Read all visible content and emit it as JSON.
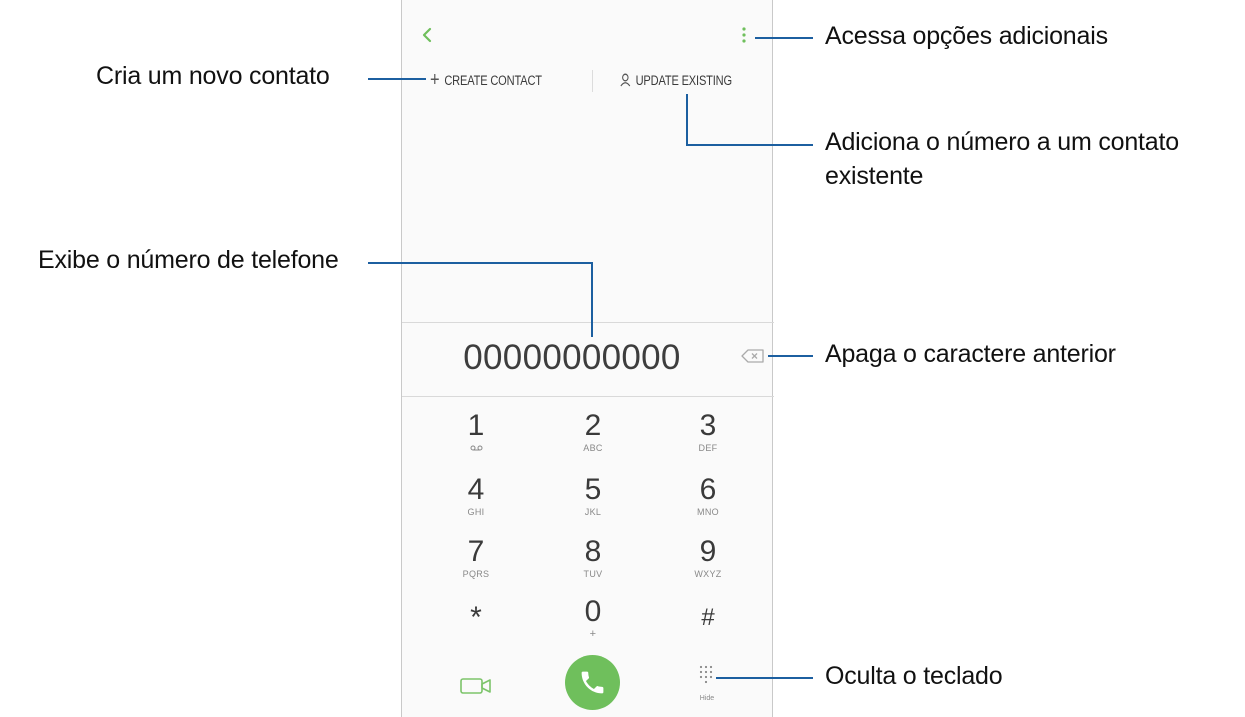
{
  "toolbar": {
    "create_contact_label": "CREATE CONTACT",
    "update_existing_label": "UPDATE EXISTING"
  },
  "display": {
    "phone_number": "00000000000"
  },
  "keypad": {
    "keys": [
      {
        "digit": "1",
        "letters": "QD"
      },
      {
        "digit": "2",
        "letters": "ABC"
      },
      {
        "digit": "3",
        "letters": "DEF"
      },
      {
        "digit": "4",
        "letters": "GHI"
      },
      {
        "digit": "5",
        "letters": "JKL"
      },
      {
        "digit": "6",
        "letters": "MNO"
      },
      {
        "digit": "7",
        "letters": "PQRS"
      },
      {
        "digit": "8",
        "letters": "TUV"
      },
      {
        "digit": "9",
        "letters": "WXYZ"
      },
      {
        "digit": "*",
        "letters": ""
      },
      {
        "digit": "0",
        "letters": "+"
      },
      {
        "digit": "#",
        "letters": ""
      }
    ],
    "hide_label": "Hide"
  },
  "callouts": {
    "more_options": "Acessa opções adicionais",
    "create_contact": "Cria um novo contato",
    "update_existing_line1": "Adiciona o número a um contato",
    "update_existing_line2": "existente",
    "phone_number": "Exibe o número de telefone",
    "backspace": "Apaga o caractere anterior",
    "hide_keypad": "Oculta o teclado"
  },
  "colors": {
    "accent_green": "#6fbf5c",
    "callout_line": "#1c5fa0"
  }
}
